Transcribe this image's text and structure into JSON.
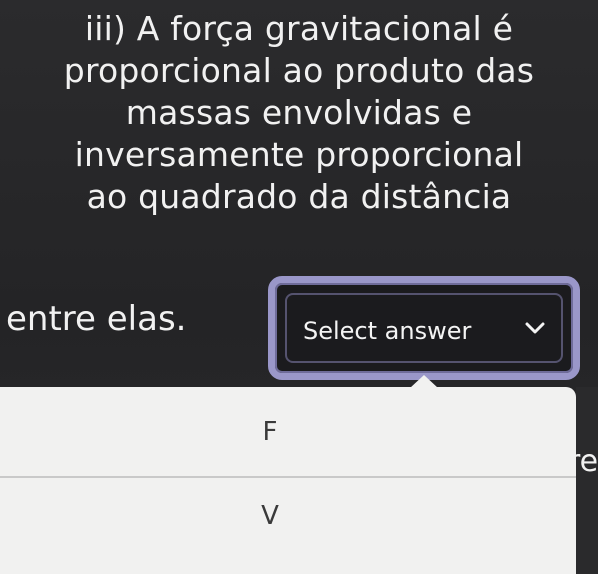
{
  "question": {
    "lines": [
      "iii) A força gravitacional é",
      "proporcional ao produto das",
      "massas envolvidas e",
      "inversamente proporcional",
      "ao quadrado da distância"
    ],
    "trailing": "entre elas."
  },
  "select": {
    "label": "Select answer",
    "icon": "chevron-down-icon"
  },
  "options": [
    {
      "label": "F"
    },
    {
      "label": "V"
    }
  ],
  "peek_text": "re",
  "colors": {
    "background": "#252527",
    "select_border": "#9a97c9",
    "dropdown_bg": "#f1f1f0",
    "option_text": "#3a3a3a"
  }
}
